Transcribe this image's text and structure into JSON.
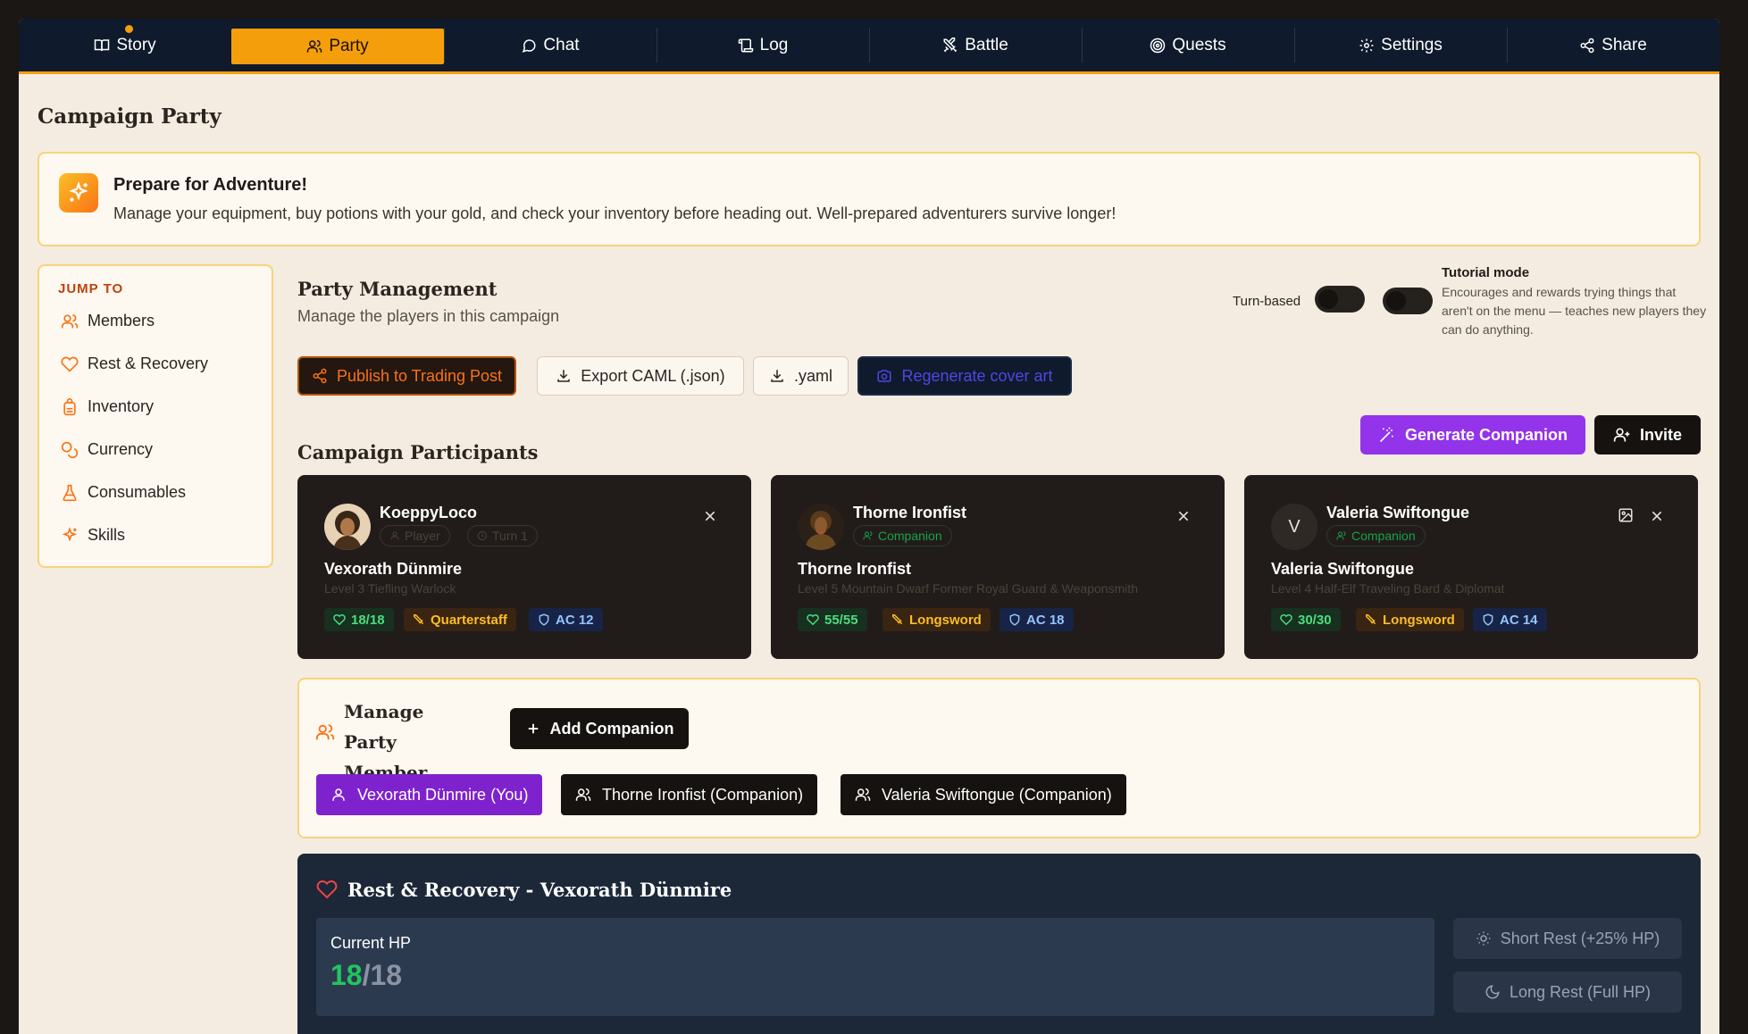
{
  "nav": {
    "tabs": [
      {
        "label": "Story",
        "icon": "book-icon"
      },
      {
        "label": "Party",
        "icon": "users-icon"
      },
      {
        "label": "Chat",
        "icon": "message-icon"
      },
      {
        "label": "Log",
        "icon": "scroll-icon"
      },
      {
        "label": "Battle",
        "icon": "swords-icon"
      },
      {
        "label": "Quests",
        "icon": "target-icon"
      },
      {
        "label": "Settings",
        "icon": "gear-icon"
      },
      {
        "label": "Share",
        "icon": "share-icon"
      }
    ],
    "active_tab": "Party",
    "accent_color": "#f59e0b"
  },
  "page": {
    "title": "Campaign Party"
  },
  "banner": {
    "title": "Prepare for Adventure!",
    "text": "Manage your equipment, buy potions with your gold, and check your inventory before heading out. Well-prepared adventurers survive longer!"
  },
  "jump": {
    "heading": "JUMP TO",
    "items": [
      {
        "label": "Members",
        "icon": "users-icon"
      },
      {
        "label": "Rest & Recovery",
        "icon": "heart-icon"
      },
      {
        "label": "Inventory",
        "icon": "backpack-icon"
      },
      {
        "label": "Currency",
        "icon": "coins-icon"
      },
      {
        "label": "Consumables",
        "icon": "flask-icon"
      },
      {
        "label": "Skills",
        "icon": "sparkles-icon"
      }
    ]
  },
  "management": {
    "title": "Party Management",
    "subtitle": "Manage the players in this campaign",
    "turn_based_label": "Turn-based",
    "tutorial_title": "Tutorial mode",
    "tutorial_text": "Encourages and rewards trying things that aren't on the menu — teaches new players they can do anything.",
    "buttons": {
      "publish": "Publish to Trading Post",
      "export": "Export CAML (.json)",
      "yaml": ".yaml",
      "regenerate": "Regenerate cover art"
    }
  },
  "participants": {
    "title": "Campaign Participants",
    "generate_label": "Generate Companion",
    "invite_label": "Invite",
    "cards": [
      {
        "username": "KoeppyLoco",
        "chips": [
          "Player",
          "Turn 1"
        ],
        "character": "Vexorath Dünmire",
        "meta": "Level 3 Tiefling Warlock",
        "hp": "18/18",
        "weapon": "Quarterstaff",
        "ac": "AC 12"
      },
      {
        "username": "Thorne Ironfist",
        "chips": [
          "Companion"
        ],
        "character": "Thorne Ironfist",
        "meta": "Level 5 Mountain Dwarf Former Royal Guard & Weaponsmith",
        "hp": "55/55",
        "weapon": "Longsword",
        "ac": "AC 18"
      },
      {
        "username": "Valeria Swiftongue",
        "avatar_letter": "V",
        "chips": [
          "Companion"
        ],
        "character": "Valeria Swiftongue",
        "meta": "Level 4 Half-Elf Traveling Bard & Diplomat",
        "hp": "30/30",
        "weapon": "Longsword",
        "ac": "AC 14"
      }
    ]
  },
  "manage_member": {
    "title": "Manage Party Member",
    "add_label": "Add Companion",
    "members": [
      {
        "label": "Vexorath Dünmire (You)",
        "selected": true
      },
      {
        "label": "Thorne Ironfist (Companion)",
        "selected": false
      },
      {
        "label": "Valeria Swiftongue (Companion)",
        "selected": false
      }
    ]
  },
  "rest": {
    "title": "Rest & Recovery - Vexorath Dünmire",
    "hp_label": "Current HP",
    "hp_current": "18",
    "hp_max": "/18",
    "short_rest": "Short Rest (+25% HP)",
    "long_rest": "Long Rest (Full HP)"
  }
}
